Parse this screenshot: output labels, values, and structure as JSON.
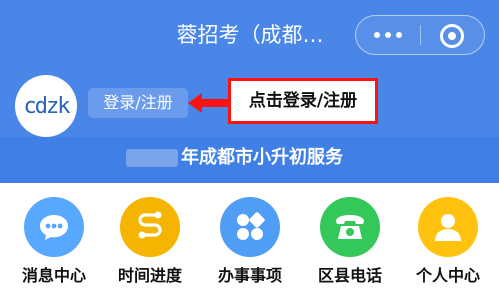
{
  "app": {
    "title": "蓉招考（成都…"
  },
  "header": {
    "avatar_text": "cdzk",
    "login_label": "登录/注册",
    "callout_text": "点击登录/注册"
  },
  "banner": {
    "text": "年成都市小升初服务"
  },
  "menu": {
    "items": [
      {
        "label": "消息中心",
        "icon": "message-bubble-icon",
        "color": "#58a8ff"
      },
      {
        "label": "时间进度",
        "icon": "progress-icon",
        "color": "#f4b400"
      },
      {
        "label": "办事事项",
        "icon": "grid-icon",
        "color": "#4f9df5"
      },
      {
        "label": "区县电话",
        "icon": "phone-icon",
        "color": "#34c759"
      },
      {
        "label": "个人中心",
        "icon": "user-icon",
        "color": "#ffc20e"
      }
    ]
  },
  "colors": {
    "header_blue": "#4a86e8",
    "banner_blue": "#3f7fe6",
    "callout_red": "#ff1111"
  }
}
